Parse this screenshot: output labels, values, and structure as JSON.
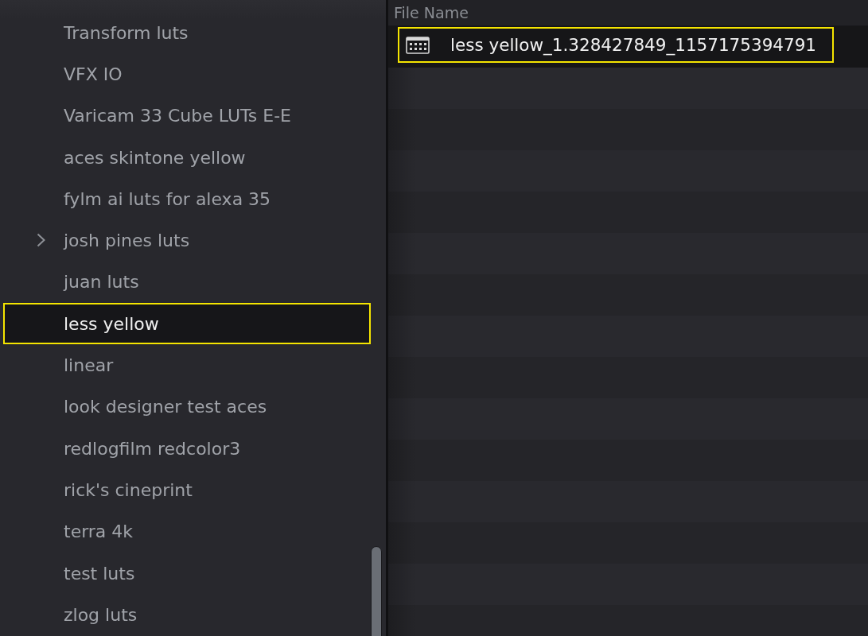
{
  "folders": [
    {
      "label": "Transform luts",
      "expandable": false,
      "selected": false,
      "outlined": false
    },
    {
      "label": "VFX IO",
      "expandable": false,
      "selected": false,
      "outlined": false
    },
    {
      "label": "Varicam 33 Cube LUTs E-E",
      "expandable": false,
      "selected": false,
      "outlined": false
    },
    {
      "label": "aces skintone yellow",
      "expandable": false,
      "selected": false,
      "outlined": false
    },
    {
      "label": "fylm ai luts for alexa 35",
      "expandable": false,
      "selected": false,
      "outlined": false
    },
    {
      "label": "josh pines luts",
      "expandable": true,
      "selected": false,
      "outlined": false
    },
    {
      "label": "juan luts",
      "expandable": false,
      "selected": false,
      "outlined": false
    },
    {
      "label": "less yellow",
      "expandable": false,
      "selected": true,
      "outlined": true
    },
    {
      "label": "linear",
      "expandable": false,
      "selected": false,
      "outlined": false
    },
    {
      "label": "look designer test aces",
      "expandable": false,
      "selected": false,
      "outlined": false
    },
    {
      "label": "redlogfilm redcolor3",
      "expandable": false,
      "selected": false,
      "outlined": false
    },
    {
      "label": "rick's cineprint",
      "expandable": false,
      "selected": false,
      "outlined": false
    },
    {
      "label": "terra 4k",
      "expandable": false,
      "selected": false,
      "outlined": false
    },
    {
      "label": "test luts",
      "expandable": false,
      "selected": false,
      "outlined": false
    },
    {
      "label": "zlog luts",
      "expandable": false,
      "selected": false,
      "outlined": false
    }
  ],
  "file_list": {
    "columns": [
      "File Name"
    ],
    "rows": [
      {
        "name": "less yellow_1.328427849_1157175394791",
        "selected": true,
        "outlined": true
      }
    ]
  }
}
